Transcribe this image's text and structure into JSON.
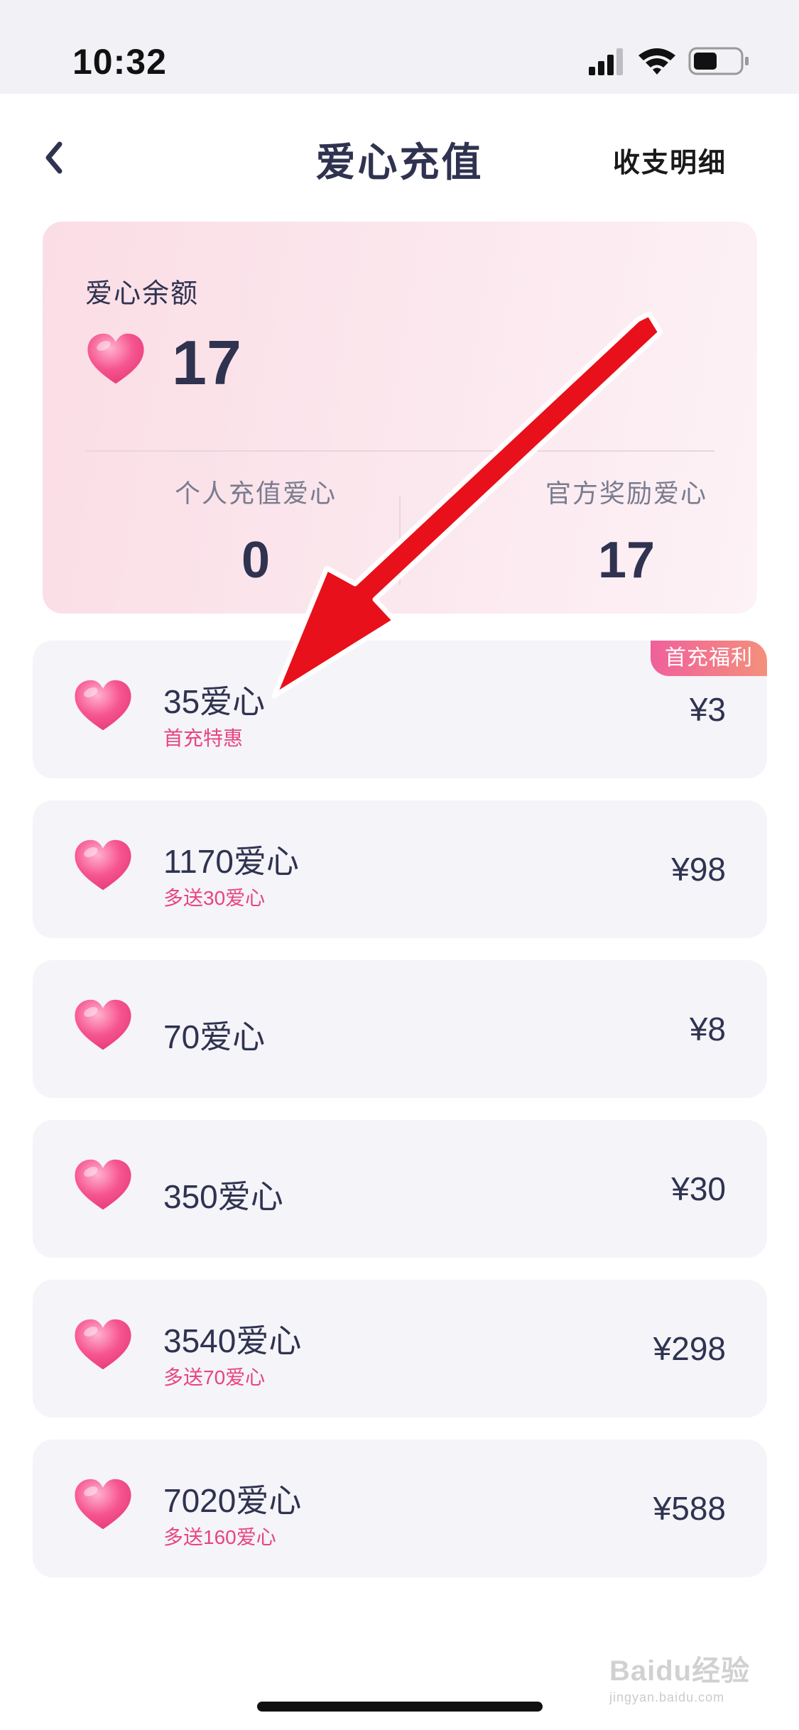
{
  "status_bar": {
    "time": "10:32"
  },
  "header": {
    "title": "爱心充值",
    "details_link": "收支明细"
  },
  "balance": {
    "label": "爱心余额",
    "value": "17",
    "personal": {
      "label": "个人充值爱心",
      "value": "0"
    },
    "official": {
      "label": "官方奖励爱心",
      "value": "17"
    }
  },
  "packages": [
    {
      "name": "35爱心",
      "note": "首充特惠",
      "price": "¥3",
      "badge": "首充福利"
    },
    {
      "name": "1170爱心",
      "note": "多送30爱心",
      "price": "¥98"
    },
    {
      "name": "70爱心",
      "price": "¥8"
    },
    {
      "name": "350爱心",
      "price": "¥30"
    },
    {
      "name": "3540爱心",
      "note": "多送70爱心",
      "price": "¥298"
    },
    {
      "name": "7020爱心",
      "note": "多送160爱心",
      "price": "¥588"
    }
  ],
  "watermark": {
    "text": "Baidu经验",
    "sub": "jingyan.baidu.com"
  },
  "colors": {
    "accent": "#e8447f",
    "text_dark": "#2f3350",
    "card_bg": "#f4f4f9",
    "arrow": "#e8101a"
  },
  "icons": [
    "back-chevron-icon",
    "heart-icon",
    "signal-icon",
    "wifi-icon",
    "battery-icon"
  ]
}
